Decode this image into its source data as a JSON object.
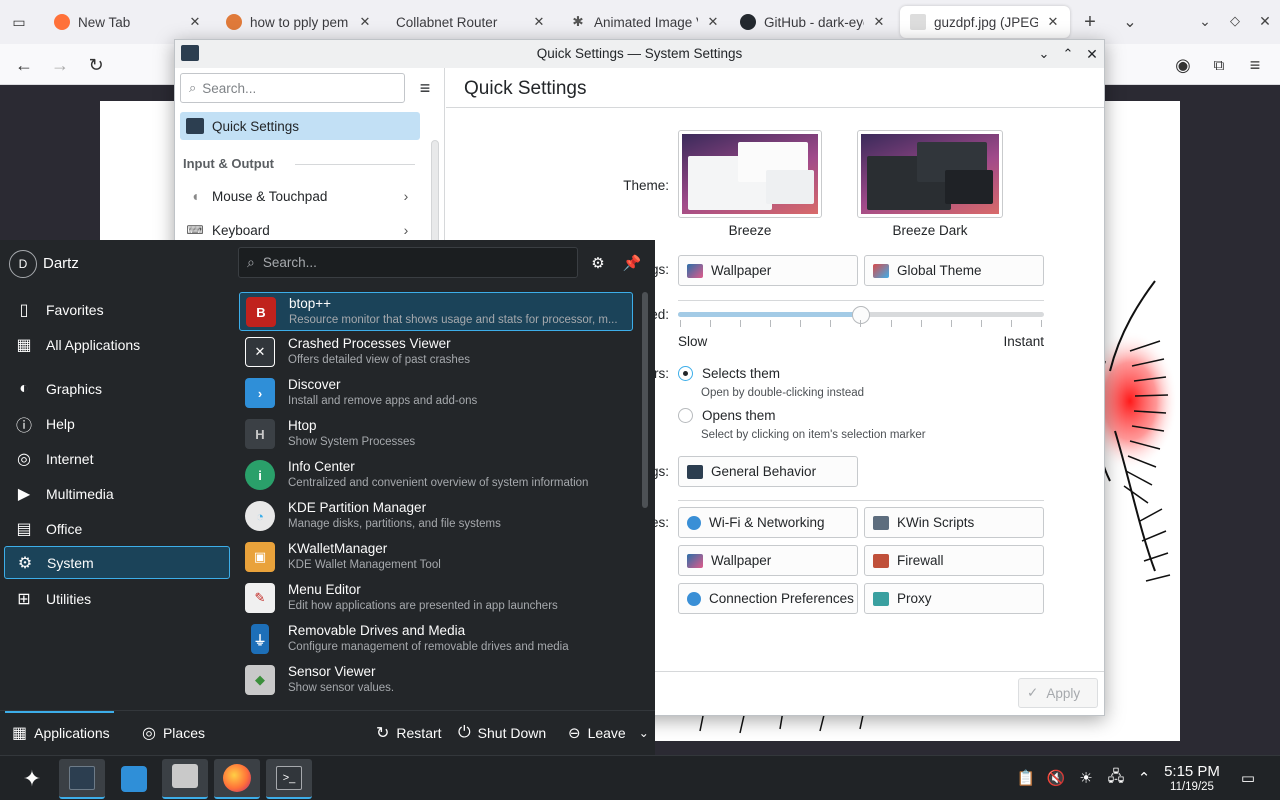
{
  "browser": {
    "tabs": [
      {
        "label": "New Tab",
        "close": "✕"
      },
      {
        "label": "how to pply pem f",
        "close": "✕"
      },
      {
        "label": "Collabnet Router",
        "close": "✕"
      },
      {
        "label": "Animated Image V",
        "close": "✕"
      },
      {
        "label": "GitHub - dark-eye",
        "close": "✕"
      },
      {
        "label": "guzdpf.jpg (JPEG i",
        "close": "✕"
      }
    ],
    "new_tab": "+",
    "list_tabs": "⌄"
  },
  "settings": {
    "window_title": "Quick Settings — System Settings",
    "search_placeholder": "Search...",
    "page_title": "Quick Settings",
    "sidebar": {
      "selected": "Quick Settings",
      "section": "Input & Output",
      "items": [
        {
          "label": "Mouse & Touchpad"
        },
        {
          "label": "Keyboard"
        }
      ]
    },
    "theme_label": "Theme:",
    "themes": [
      {
        "name": "Breeze"
      },
      {
        "name": "Breeze Dark"
      }
    ],
    "row_labels": {
      "more_appearance": "gs:",
      "animation": "ed:",
      "clicking": "rs:",
      "more_behavior": "gs:",
      "most_used": "es:"
    },
    "appearance_buttons": [
      "Wallpaper",
      "Global Theme"
    ],
    "slider": {
      "min_label": "Slow",
      "max_label": "Instant",
      "value_fraction": 0.5
    },
    "click_behavior": [
      {
        "label": "Selects them",
        "hint": "Open by double-clicking instead",
        "checked": true
      },
      {
        "label": "Opens them",
        "hint": "Select by clicking on item's selection marker",
        "checked": false
      }
    ],
    "behavior_button": "General Behavior",
    "most_used": [
      "Wi-Fi & Networking",
      "KWin Scripts",
      "Wallpaper",
      "Firewall",
      "Connection Preferences",
      "Proxy"
    ],
    "apply": "Apply"
  },
  "launcher": {
    "user": "Dartz",
    "avatar_letter": "D",
    "search_placeholder": "Search...",
    "categories": [
      "Favorites",
      "All Applications",
      "Graphics",
      "Help",
      "Internet",
      "Multimedia",
      "Office",
      "System",
      "Utilities"
    ],
    "selected_category": "System",
    "apps": [
      {
        "name": "btop++",
        "desc": "Resource monitor that shows usage and stats for processor, m..."
      },
      {
        "name": "Crashed Processes Viewer",
        "desc": "Offers detailed view of past crashes"
      },
      {
        "name": "Discover",
        "desc": "Install and remove apps and add-ons"
      },
      {
        "name": "Htop",
        "desc": "Show System Processes"
      },
      {
        "name": "Info Center",
        "desc": "Centralized and convenient overview of system information"
      },
      {
        "name": "KDE Partition Manager",
        "desc": "Manage disks, partitions, and file systems"
      },
      {
        "name": "KWalletManager",
        "desc": "KDE Wallet Management Tool"
      },
      {
        "name": "Menu Editor",
        "desc": "Edit how applications are presented in app launchers"
      },
      {
        "name": "Removable Drives and Media",
        "desc": "Configure management of removable drives and media"
      },
      {
        "name": "Sensor Viewer",
        "desc": "Show sensor values."
      }
    ],
    "footer": {
      "applications": "Applications",
      "places": "Places",
      "restart": "Restart",
      "shutdown": "Shut Down",
      "leave": "Leave"
    }
  },
  "taskbar": {
    "time": "5:15 PM",
    "date": "11/19/25"
  },
  "colors": {
    "accent": "#3daee9",
    "selection": "#1b4359",
    "panel": "#202326",
    "launcher_bg": "#232629"
  }
}
